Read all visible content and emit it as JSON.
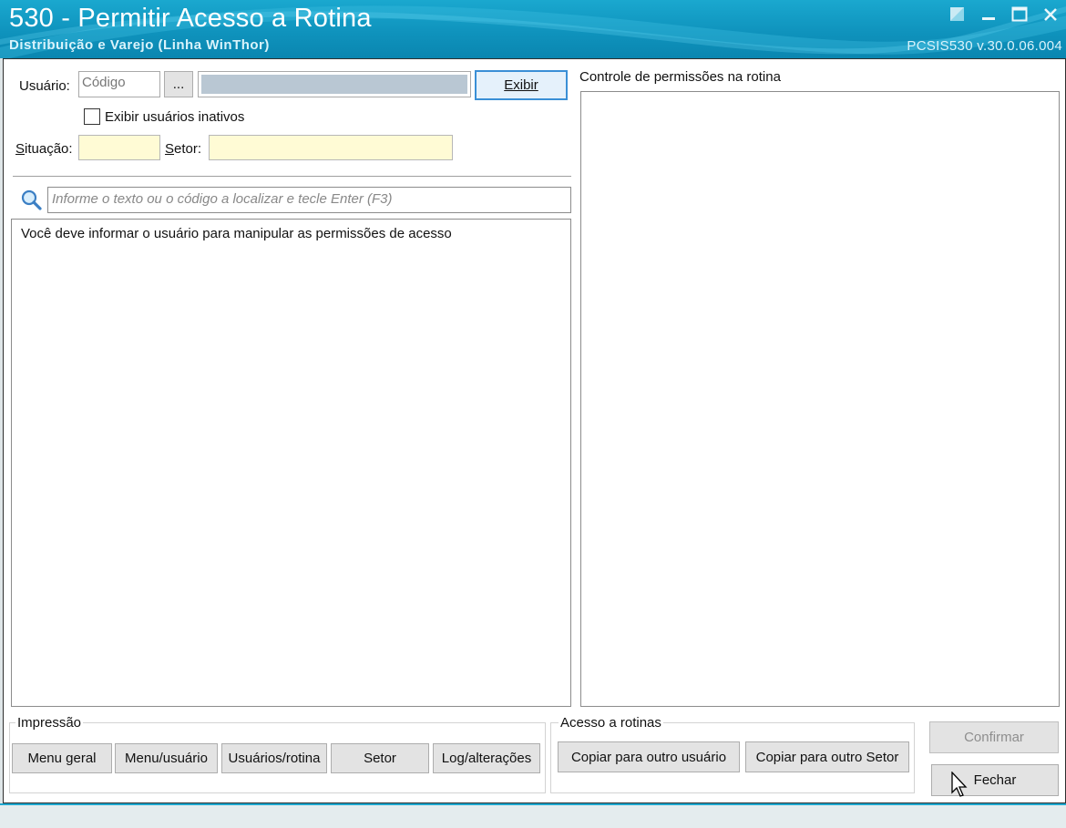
{
  "window": {
    "title": "530 - Permitir Acesso a Rotina",
    "subtitle": "Distribuição e Varejo (Linha WinThor)",
    "version": "PCSIS530  v.30.0.06.004"
  },
  "filters": {
    "usuario_label": "Usuário:",
    "codigo_placeholder": "Código",
    "lookup_button": "...",
    "exibir_button": "Exibir",
    "inativos_label": "Exibir usuários inativos",
    "inativos_checked": false,
    "situacao_label": "Situação:",
    "setor_label": "Setor:"
  },
  "search": {
    "placeholder": "Informe o texto ou o código a localizar e tecle Enter (F3)"
  },
  "left_list": {
    "message": "Você deve informar o usuário para manipular as permissões de acesso"
  },
  "right_panel": {
    "title": "Controle de permissões na rotina"
  },
  "impressao": {
    "title": "Impressão",
    "buttons": [
      "Menu geral",
      "Menu/usuário",
      "Usuários/rotina",
      "Setor",
      "Log/alterações"
    ]
  },
  "acesso": {
    "title": "Acesso a rotinas",
    "buttons": [
      "Copiar para outro usuário",
      "Copiar para outro Setor"
    ]
  },
  "actions": {
    "confirmar": "Confirmar",
    "fechar": "Fechar"
  },
  "colors": {
    "title_bar": "#0f93bd",
    "field_yellow": "#fffbd5",
    "focus_border": "#3a8fd6"
  }
}
